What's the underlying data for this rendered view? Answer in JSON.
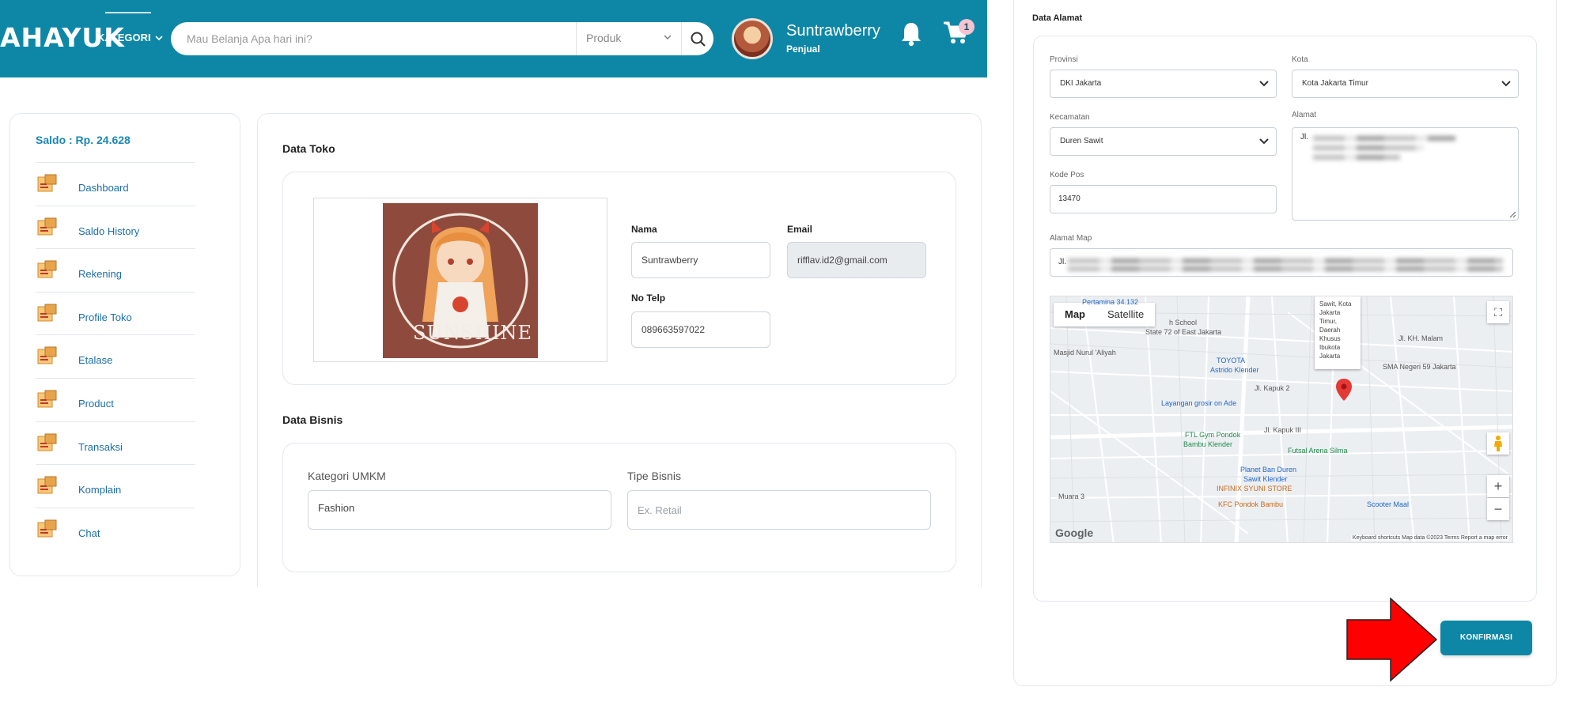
{
  "header": {
    "logo": "AHAYUK",
    "kategori_label": "KATEGORI",
    "search_placeholder": "Mau Belanja Apa hari ini?",
    "search_category": "Produk",
    "user_name": "Suntrawberry",
    "user_role": "Penjual",
    "cart_count": "1",
    "brand_color": "#0e87a6"
  },
  "sidebar": {
    "saldo": "Saldo : Rp. 24.628",
    "items": [
      {
        "label": "Dashboard",
        "icon": "dashboard-icon"
      },
      {
        "label": "Saldo History",
        "icon": "saldo-history-icon"
      },
      {
        "label": "Rekening",
        "icon": "rekening-icon"
      },
      {
        "label": "Profile Toko",
        "icon": "store-icon"
      },
      {
        "label": "Etalase",
        "icon": "etalase-icon"
      },
      {
        "label": "Product",
        "icon": "product-icon"
      },
      {
        "label": "Transaksi",
        "icon": "transaksi-icon"
      },
      {
        "label": "Komplain",
        "icon": "komplain-icon"
      },
      {
        "label": "Chat",
        "icon": "chat-icon"
      }
    ]
  },
  "toko": {
    "title": "Data Toko",
    "nama_label": "Nama",
    "nama_value": "Suntrawberry",
    "email_label": "Email",
    "email_value": "rifflav.id2@gmail.com",
    "telp_label": "No Telp",
    "telp_value": "089663597022",
    "image_text": "SUNSHINE"
  },
  "bisnis": {
    "title": "Data Bisnis",
    "kategori_label": "Kategori UMKM",
    "kategori_value": "Fashion",
    "tipe_label": "Tipe Bisnis",
    "tipe_placeholder": "Ex. Retail"
  },
  "alamat": {
    "title": "Data Alamat",
    "provinsi_label": "Provinsi",
    "provinsi_value": "DKI Jakarta",
    "kota_label": "Kota",
    "kota_value": "Kota Jakarta Timur",
    "kecamatan_label": "Kecamatan",
    "kecamatan_value": "Duren Sawit",
    "alamat_label": "Alamat",
    "alamat_value": "Jl. ",
    "kodepos_label": "Kode Pos",
    "kodepos_value": "13470",
    "alamat_map_label": "Alamat Map",
    "alamat_map_value": "Jl. "
  },
  "map": {
    "tab_map": "Map",
    "tab_satellite": "Satellite",
    "labels": [
      {
        "text": "Pertamina 34.132",
        "cls": "blue"
      },
      {
        "text": "h School",
        "cls": ""
      },
      {
        "text": "State 72 of East Jakarta",
        "cls": ""
      },
      {
        "text": "Masjid Nurul 'Aliyah",
        "cls": ""
      },
      {
        "text": "TOYOTA",
        "cls": "blue"
      },
      {
        "text": "Astrido Klender",
        "cls": "blue"
      },
      {
        "text": "Jl. Kapuk 2",
        "cls": ""
      },
      {
        "text": "SMA Negeri 59 Jakarta",
        "cls": ""
      },
      {
        "text": "Layangan grosir on Ade",
        "cls": "blue"
      },
      {
        "text": "FTL Gym Pondok",
        "cls": "green"
      },
      {
        "text": "Bambu Klender",
        "cls": "green"
      },
      {
        "text": "Futsal Arena Silma",
        "cls": "green"
      },
      {
        "text": "Planet Ban Duren",
        "cls": "blue"
      },
      {
        "text": "Sawit Klender",
        "cls": "blue"
      },
      {
        "text": "INFINIX SYUNI STORE",
        "cls": "orange"
      },
      {
        "text": "KFC Pondok Bambu",
        "cls": "orange"
      },
      {
        "text": "Scooter Maal",
        "cls": "blue"
      },
      {
        "text": "Jl. KH. Malam",
        "cls": ""
      },
      {
        "text": "Jl. Kapuk III",
        "cls": ""
      },
      {
        "text": "Muara 3",
        "cls": ""
      }
    ],
    "popup_lines": [
      "Sawit, Kota",
      "Jakarta",
      "Timur,",
      "Daerah",
      "Khusus",
      "Ibukota",
      "Jakarta"
    ],
    "google": "Google",
    "footer": "Keyboard shortcuts   Map data ©2023   Terms   Report a map error"
  },
  "confirm_label": "KONFIRMASI"
}
